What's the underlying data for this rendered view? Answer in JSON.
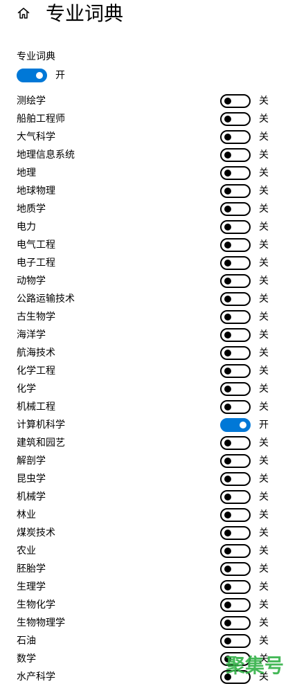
{
  "header": {
    "title": "专业词典",
    "home_icon": "home-icon"
  },
  "section": {
    "label": "专业词典",
    "enabled": true,
    "state_text": "开"
  },
  "colors": {
    "accent": "#0078d7",
    "text": "#000000",
    "background": "#ffffff",
    "watermark": "#36b34a"
  },
  "dictionaries": [
    {
      "label": "测绘学",
      "on": false,
      "state": "关"
    },
    {
      "label": "船舶工程师",
      "on": false,
      "state": "关"
    },
    {
      "label": "大气科学",
      "on": false,
      "state": "关"
    },
    {
      "label": "地理信息系统",
      "on": false,
      "state": "关"
    },
    {
      "label": "地理",
      "on": false,
      "state": "关"
    },
    {
      "label": "地球物理",
      "on": false,
      "state": "关"
    },
    {
      "label": "地质学",
      "on": false,
      "state": "关"
    },
    {
      "label": "电力",
      "on": false,
      "state": "关"
    },
    {
      "label": "电气工程",
      "on": false,
      "state": "关"
    },
    {
      "label": "电子工程",
      "on": false,
      "state": "关"
    },
    {
      "label": "动物学",
      "on": false,
      "state": "关"
    },
    {
      "label": "公路运输技术",
      "on": false,
      "state": "关"
    },
    {
      "label": "古生物学",
      "on": false,
      "state": "关"
    },
    {
      "label": "海洋学",
      "on": false,
      "state": "关"
    },
    {
      "label": "航海技术",
      "on": false,
      "state": "关"
    },
    {
      "label": "化学工程",
      "on": false,
      "state": "关"
    },
    {
      "label": "化学",
      "on": false,
      "state": "关"
    },
    {
      "label": "机械工程",
      "on": false,
      "state": "关"
    },
    {
      "label": "计算机科学",
      "on": true,
      "state": "开"
    },
    {
      "label": "建筑和园艺",
      "on": false,
      "state": "关"
    },
    {
      "label": "解剖学",
      "on": false,
      "state": "关"
    },
    {
      "label": "昆虫学",
      "on": false,
      "state": "关"
    },
    {
      "label": "机械学",
      "on": false,
      "state": "关"
    },
    {
      "label": "林业",
      "on": false,
      "state": "关"
    },
    {
      "label": "煤炭技术",
      "on": false,
      "state": "关"
    },
    {
      "label": "农业",
      "on": false,
      "state": "关"
    },
    {
      "label": "胚胎学",
      "on": false,
      "state": "关"
    },
    {
      "label": "生理学",
      "on": false,
      "state": "关"
    },
    {
      "label": "生物化学",
      "on": false,
      "state": "关"
    },
    {
      "label": "生物物理学",
      "on": false,
      "state": "关"
    },
    {
      "label": "石油",
      "on": false,
      "state": "关"
    },
    {
      "label": "数学",
      "on": false,
      "state": "关"
    },
    {
      "label": "水产科学",
      "on": false,
      "state": "关"
    }
  ],
  "watermark": {
    "text": "聚集号"
  }
}
